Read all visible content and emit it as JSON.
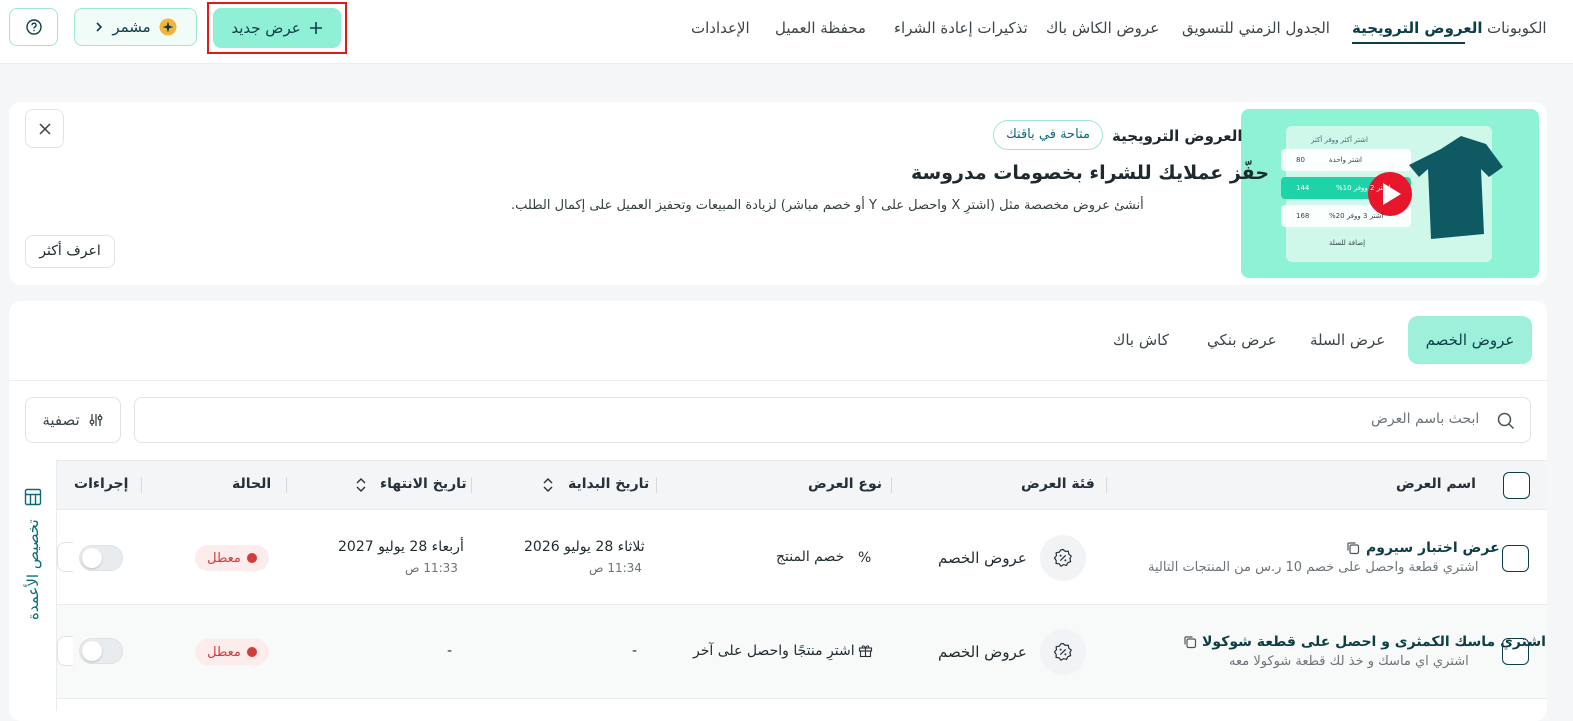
{
  "nav": {
    "items": [
      "الكوبونات",
      "العروض الترويجية",
      "الجدول الزمني للتسويق",
      "عروض الكاش باك",
      "تذكيرات إعادة الشراء",
      "محفظة العميل",
      "الإعدادات"
    ],
    "active": "العروض الترويجية",
    "new_offer_label": "عرض جديد",
    "mushir_label": "مشمر"
  },
  "banner": {
    "title": "العروض الترويجية",
    "badge": "متاحة في باقتك",
    "headline": "حفّز عملايك للشراء بخصومات مدروسة",
    "description": "أنشئ عروض مخصصة مثل (اشترِ X واحصل على Y أو خصم مباشر) لزيادة المبيعات وتحفيز العميل على إكمال الطلب.",
    "learn_more": "اعرف أكثر",
    "preview": {
      "header": "اشتر أكثر ووفر أكثر",
      "row1_label": "اشتر واحدة",
      "row1_price": "80",
      "row2_label": "اشتر 2 ووفر 10%",
      "row2_price": "144",
      "row3_label": "اشتر 3 ووفر 20%",
      "row3_price": "168",
      "cta": "إضافة للسلة"
    }
  },
  "tabs": [
    "عروض الخصم",
    "عرض السلة",
    "عرض بنكي",
    "كاش باك"
  ],
  "active_tab": "عروض الخصم",
  "search": {
    "placeholder": "ابحث باسم العرض"
  },
  "filter_label": "تصفية",
  "table": {
    "headers": {
      "name": "اسم العرض",
      "category": "فئة العرض",
      "type": "نوع العرض",
      "start": "تاريخ البداية",
      "end": "تاريخ الانتهاء",
      "status": "الحالة",
      "actions": "إجراءات"
    },
    "rows": [
      {
        "name": "عرض اختبار سيروم",
        "description": "اشتري قطعة واحصل على خصم 10 ر.س من المنتجات التالية",
        "category": "عروض الخصم",
        "type": "خصم المنتج",
        "start_date": "ثلاثاء 28 يوليو 2026",
        "start_time": "11:34 ص",
        "end_date": "أربعاء 28 يوليو 2027",
        "end_time": "11:33 ص",
        "status": "معطل",
        "enabled": false
      },
      {
        "name": "اشتري ماسك الكمثرى و احصل على قطعة شوكولا",
        "description": "اشتري اي ماسك و خذ لك قطعة شوكولا معه",
        "category": "عروض الخصم",
        "type": "اشترِ منتجًا واحصل على آخر",
        "start_date": "-",
        "start_time": "",
        "end_date": "-",
        "end_time": "",
        "status": "معطل",
        "enabled": false
      }
    ]
  },
  "customize_columns_label": "تخصيص الأعمدة",
  "colors": {
    "accent": "#8ff0d6",
    "dark": "#0c3e47",
    "danger": "#d13c3c"
  }
}
